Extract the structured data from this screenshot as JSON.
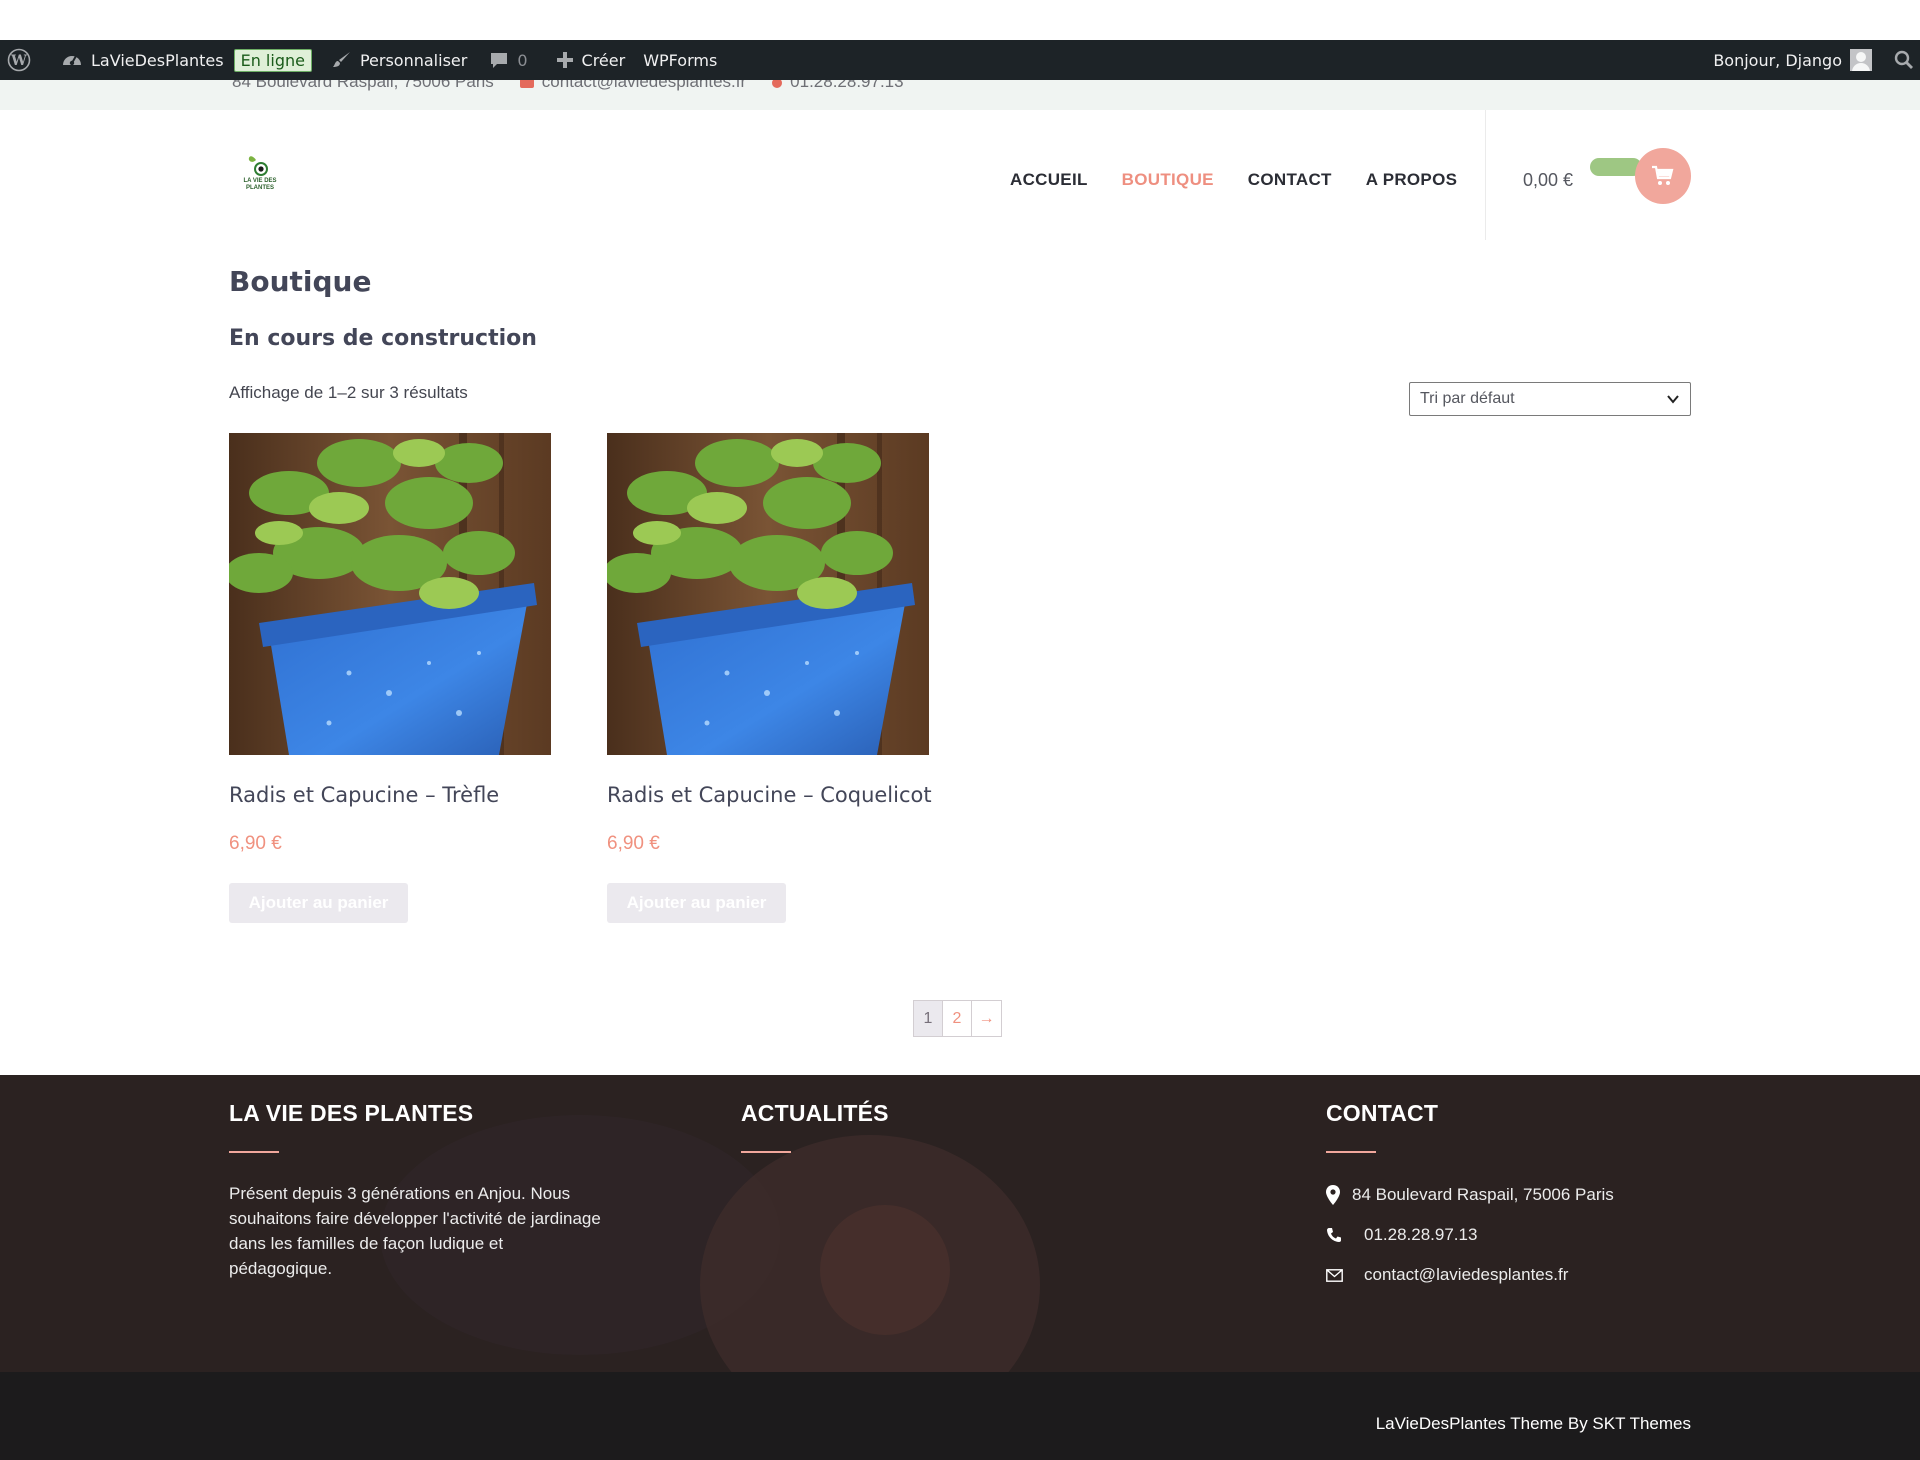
{
  "adminbar": {
    "site_name": "LaVieDesPlantes",
    "status": "En ligne",
    "customize": "Personnaliser",
    "comments_count": "0",
    "create": "Créer",
    "wpforms": "WPForms",
    "greeting": "Bonjour, Django"
  },
  "topbar": {
    "address": "84 Boulevard Raspail, 75006 Paris",
    "email": "contact@laviedesplantes.fr",
    "phone": "01.28.28.97.13"
  },
  "header": {
    "logo_text": "LA VIE DES PLANTES",
    "nav": [
      {
        "label": "ACCUEIL",
        "active": false
      },
      {
        "label": "BOUTIQUE",
        "active": true
      },
      {
        "label": "CONTACT",
        "active": false
      },
      {
        "label": "A PROPOS",
        "active": false
      }
    ],
    "cart_total": "0,00 €"
  },
  "main": {
    "title": "Boutique",
    "subtitle": "En cours de construction",
    "result_count": "Affichage de 1–2 sur 3 résultats",
    "sort_selected": "Tri par défaut",
    "products": [
      {
        "title": "Radis et Capucine – Trèfle",
        "price": "6,90 €",
        "button": "Ajouter au panier"
      },
      {
        "title": "Radis et Capucine – Coquelicot",
        "price": "6,90 €",
        "button": "Ajouter au panier"
      }
    ],
    "pagination": {
      "current": "1",
      "next_page": "2",
      "next_arrow": "→"
    }
  },
  "footer": {
    "col1": {
      "title": "LA VIE DES PLANTES",
      "text": "Présent depuis 3 générations en Anjou. Nous souhaitons faire développer l'activité de jardinage dans les familles de façon ludique et pédagogique."
    },
    "col2": {
      "title": "ACTUALITÉS"
    },
    "col3": {
      "title": "CONTACT",
      "address": "84 Boulevard Raspail, 75006 Paris",
      "phone": "01.28.28.97.13",
      "email": "contact@laviedesplantes.fr"
    },
    "credit": "LaVieDesPlantes Theme By SKT Themes"
  },
  "colors": {
    "accent": "#f0917f",
    "cart_green": "#9ec783",
    "admin_bg": "#1d2327",
    "footer_bg": "#2b2221"
  },
  "icons": [
    "wordpress-icon",
    "dashboard-icon",
    "brush-icon",
    "comment-icon",
    "plus-icon",
    "avatar",
    "search-icon",
    "cart-icon",
    "map-pin-icon",
    "phone-icon",
    "envelope-icon",
    "chevron-down-icon"
  ]
}
